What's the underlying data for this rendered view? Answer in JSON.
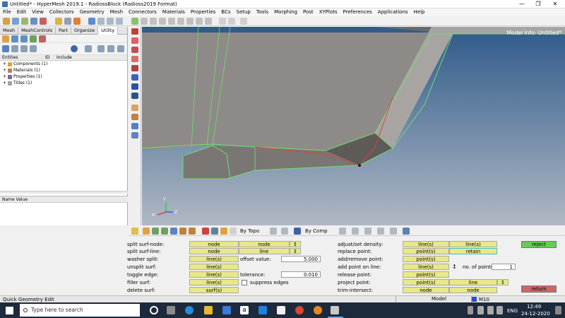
{
  "window": {
    "title": "Untitled* - HyperMesh 2019.1 - RadiossBlock (Radioss2019 Format)"
  },
  "menu": [
    "File",
    "Edit",
    "View",
    "Collectors",
    "Geometry",
    "Mesh",
    "Connectors",
    "Materials",
    "Properties",
    "BCs",
    "Setup",
    "Tools",
    "Morphing",
    "Post",
    "XYPlots",
    "Preferences",
    "Applications",
    "Help"
  ],
  "left_tabs": [
    "Mesh",
    "MeshControls",
    "Part",
    "Organize",
    "Utility"
  ],
  "entities_header": {
    "col1": "Entities",
    "col2": "ID",
    "col3": "Include"
  },
  "tree": [
    "Components (1)",
    "Materials (1)",
    "Properties (1)",
    "Titles (1)"
  ],
  "name_value_header": "Name Value",
  "viewport": {
    "model_info": "Model Info: Untitled*"
  },
  "bottom_toolbar": {
    "by_topo": "By Topo",
    "by_comp": "By Comp"
  },
  "panel": {
    "split_surf_node": {
      "label": "split surf-node:",
      "b1": "node",
      "b2": "node"
    },
    "split_surf_line": {
      "label": "split surf-line:",
      "b1": "node",
      "b2": "line"
    },
    "washer_split": {
      "label": "washer split:",
      "b1": "line(s)",
      "offset_label": "offset value:",
      "offset_value": "5.000"
    },
    "unsplit_surf": {
      "label": "unsplit surf:",
      "b1": "line(s)"
    },
    "toggle_edge": {
      "label": "toggle edge:",
      "b1": "line(s)",
      "tol_label": "tolerance:",
      "tol_value": "0.010"
    },
    "filler_surf": {
      "label": "filler surf:",
      "b1": "line(s)",
      "suppress": "suppress edges"
    },
    "delete_surf": {
      "label": "delete surf:",
      "b1": "surf(s)"
    },
    "adjust_density": {
      "label": "adjust/set density:",
      "b1": "line(s)",
      "b2": "line(s)"
    },
    "replace_point": {
      "label": "replace point:",
      "b1": "point(s)",
      "b2": "retain"
    },
    "add_remove_point": {
      "label": "add/remove point:",
      "b1": "point(s)"
    },
    "add_point_on_line": {
      "label": "add point on line:",
      "b1": "line(s)",
      "npoints_label": "no. of points",
      "npoints_value": "1"
    },
    "release_point": {
      "label": "release point:",
      "b1": "point(s)"
    },
    "project_point": {
      "label": "project point:",
      "b1": "point(s)",
      "b2": "line"
    },
    "trim_intersect": {
      "label": "trim-intersect:",
      "b1": "node",
      "b2": "node"
    },
    "reject": "reject",
    "return": "return"
  },
  "statusbar": {
    "left": "Quick Geometry Edit",
    "model": "Model",
    "comp": "M10"
  },
  "taskbar": {
    "search": "Type here to search",
    "lang": "ENG",
    "time": "12:49",
    "date": "24-12-2020"
  }
}
